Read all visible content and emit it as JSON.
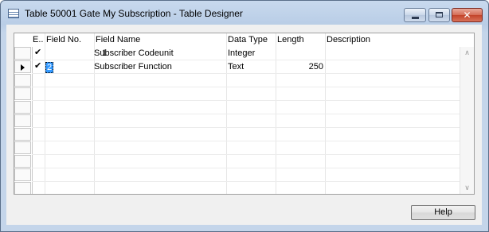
{
  "window": {
    "title": "Table 50001 Gate My Subscription - Table Designer",
    "close_glyph": "✕"
  },
  "grid": {
    "columns": [
      "E..",
      "Field No.",
      "Field Name",
      "Data Type",
      "Length",
      "Description"
    ],
    "rows": [
      {
        "enabled": "✔",
        "field_no": "1",
        "field_name": "Subscriber Codeunit",
        "data_type": "Integer",
        "length": "",
        "description": ""
      },
      {
        "enabled": "✔",
        "field_no": "2",
        "field_name": "Subscriber Function",
        "data_type": "Text",
        "length": "250",
        "description": ""
      }
    ],
    "scroll_up": "∧",
    "scroll_down": "∨"
  },
  "footer": {
    "help_label": "Help"
  }
}
